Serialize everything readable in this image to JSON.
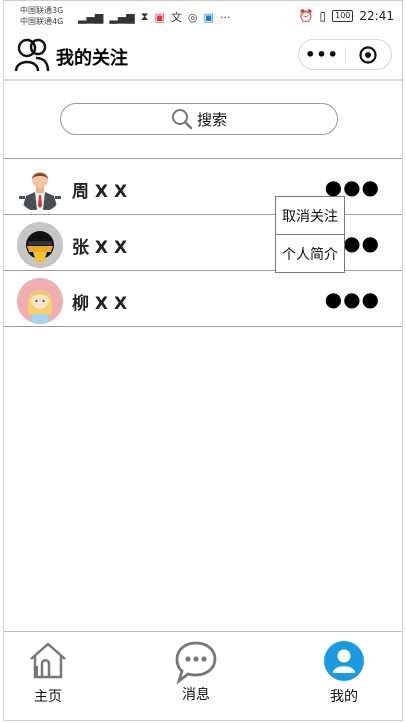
{
  "status_bar": {
    "carrier1": "中国联通3G",
    "carrier2": "中国联通4G",
    "time": "22:41",
    "battery": "100"
  },
  "header": {
    "title": "我的关注",
    "more_label": "•••"
  },
  "search": {
    "label": "搜索"
  },
  "follows": [
    {
      "name": "周 X X",
      "more": "●●●",
      "avatar": "man-in-suit"
    },
    {
      "name": "张 X X",
      "more": "●●●",
      "avatar": "helmet-person"
    },
    {
      "name": "柳 X X",
      "more": "●●●",
      "avatar": "blonde-girl"
    }
  ],
  "popup_menu": {
    "items": [
      "取消关注",
      "个人简介"
    ]
  },
  "tabs": [
    {
      "label": "主页",
      "icon": "home-icon"
    },
    {
      "label": "消息",
      "icon": "message-icon"
    },
    {
      "label": "我的",
      "icon": "user-icon"
    }
  ],
  "colors": {
    "accent": "#1a9be0",
    "divider": "#9c9c9c"
  }
}
